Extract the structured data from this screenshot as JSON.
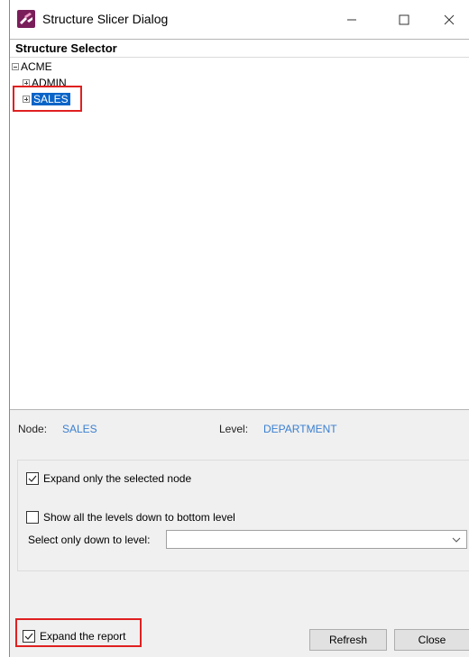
{
  "window": {
    "title": "Structure Slicer Dialog",
    "controls": {
      "minimize": "minimize",
      "maximize": "maximize",
      "close": "close"
    }
  },
  "structure_selector": {
    "heading": "Structure Selector",
    "tree": [
      {
        "label": "ACME",
        "state": "expanded",
        "depth": 0
      },
      {
        "label": "ADMIN",
        "state": "collapsed",
        "depth": 1
      },
      {
        "label": "SALES",
        "state": "collapsed",
        "depth": 1,
        "selected": true
      }
    ]
  },
  "info": {
    "node_label": "Node:",
    "node_value": "SALES",
    "level_label": "Level:",
    "level_value": "DEPARTMENT"
  },
  "options": {
    "expand_selected_label": "Expand only the selected node",
    "expand_selected_checked": true,
    "show_all_levels_label": "Show all the levels down to bottom level",
    "show_all_levels_checked": false,
    "select_down_label": "Select only down to level:",
    "select_down_value": ""
  },
  "footer": {
    "expand_report_label": "Expand the report",
    "expand_report_checked": true,
    "refresh_label": "Refresh",
    "close_label": "Close"
  },
  "colors": {
    "accent_selection": "#0a64c8",
    "info_value": "#3a7fd0",
    "annotation_red": "#e02020"
  }
}
